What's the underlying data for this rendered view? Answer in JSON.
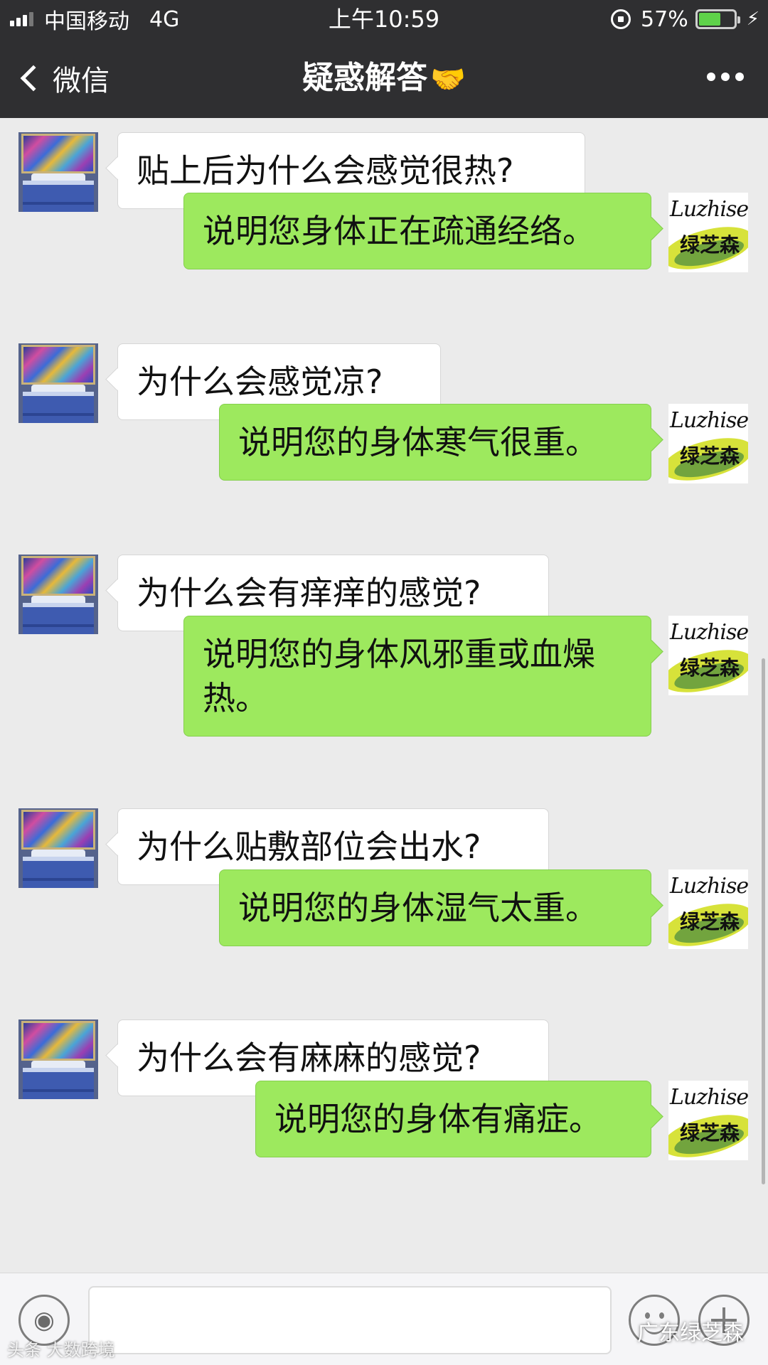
{
  "status_bar": {
    "carrier": "中国移动",
    "network": "4G",
    "time": "上午10:59",
    "battery_percent": "57%",
    "battery_level": 0.57
  },
  "nav": {
    "back_label": "微信",
    "title": "疑惑解答",
    "title_emoji": "🤝"
  },
  "bot_avatar": {
    "brand_latin": "Luzhisen",
    "brand_cn": "绿芝森"
  },
  "messages": [
    {
      "side": "in",
      "text": "贴上后为什么会感觉很热?"
    },
    {
      "side": "out",
      "text": "说明您身体正在疏通经络。"
    },
    {
      "side": "in",
      "text": "为什么会感觉凉?"
    },
    {
      "side": "out",
      "text": "说明您的身体寒气很重。"
    },
    {
      "side": "in",
      "text": "为什么会有痒痒的感觉?"
    },
    {
      "side": "out",
      "text": "说明您的身体风邪重或血燥热。"
    },
    {
      "side": "in",
      "text": "为什么贴敷部位会出水?"
    },
    {
      "side": "out",
      "text": "说明您的身体湿气太重。"
    },
    {
      "side": "in",
      "text": "为什么会有麻麻的感觉?"
    },
    {
      "side": "out",
      "text": "说明您的身体有痛症。"
    }
  ],
  "watermarks": {
    "left": "头条 大数跨境",
    "right": "广东绿芝森"
  },
  "colors": {
    "nav_bg": "#2f2f31",
    "chat_bg": "#ebebeb",
    "bubble_out": "#9de95e",
    "bubble_in": "#ffffff"
  }
}
